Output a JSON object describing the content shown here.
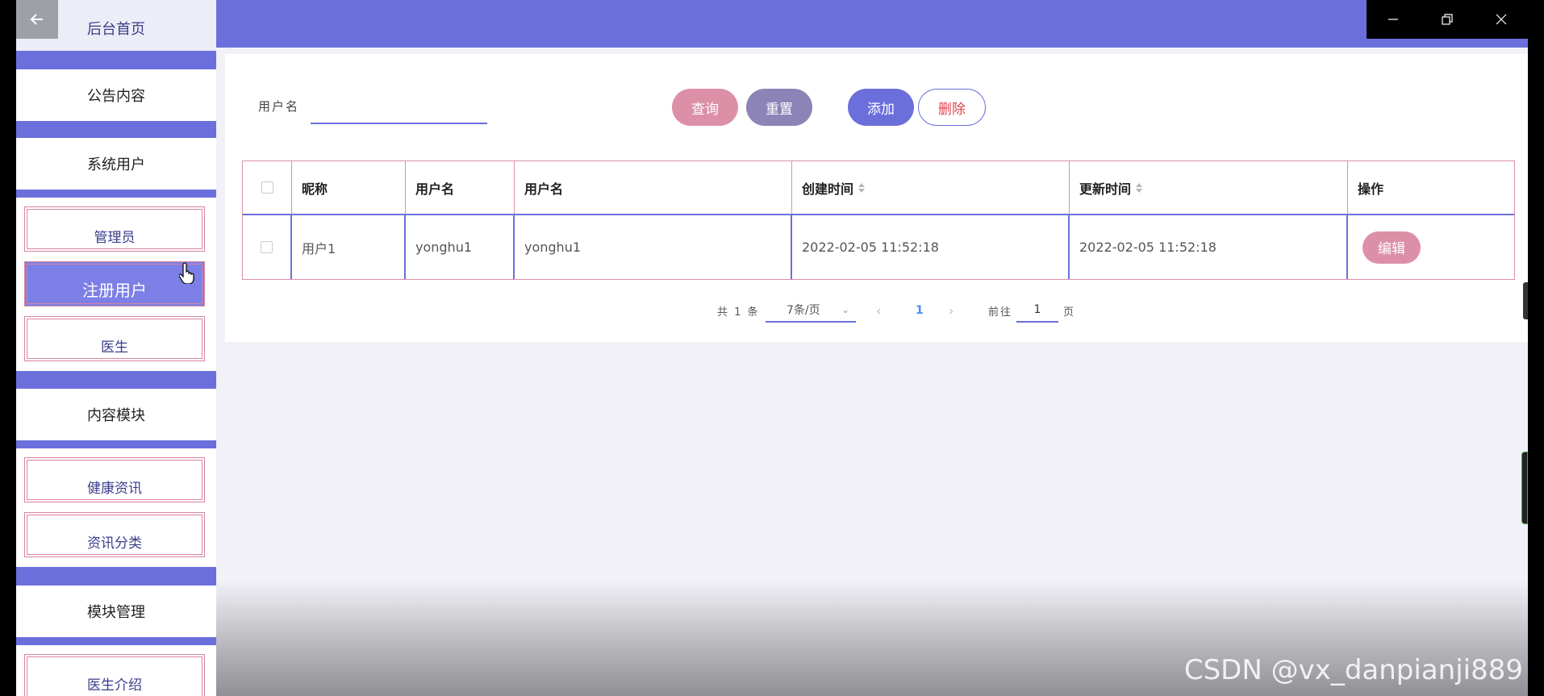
{
  "sidebar": {
    "home": "后台首页",
    "sections": [
      {
        "label": "公告内容"
      },
      {
        "label": "系统用户"
      },
      {
        "label": "内容模块"
      },
      {
        "label": "模块管理"
      }
    ],
    "sub_items": {
      "system_users": [
        "管理员",
        "注册用户",
        "医生"
      ],
      "content": [
        "健康资讯",
        "资讯分类"
      ],
      "modules": [
        "医生介绍"
      ]
    },
    "active_item": "注册用户"
  },
  "search": {
    "label": "用户名",
    "value": "",
    "placeholder": ""
  },
  "toolbar": {
    "query_label": "查询",
    "reset_label": "重置",
    "add_label": "添加",
    "delete_label": "删除"
  },
  "table": {
    "headers": [
      "昵称",
      "用户名",
      "用户名",
      "创建时间",
      "更新时间",
      "操作"
    ],
    "rows": [
      {
        "nickname": "用户1",
        "username": "yonghu1",
        "username2": "yonghu1",
        "created": "2022-02-05 11:52:18",
        "updated": "2022-02-05 11:52:18",
        "edit_label": "编辑"
      }
    ]
  },
  "pagination": {
    "total": "共 1 条",
    "page_size": "7条/页",
    "current_page": "1",
    "goto_label": "前往",
    "goto_value": "1",
    "page_suffix": "页"
  },
  "watermark": "CSDN @vx_danpianji889",
  "colors": {
    "primary": "#6b6fdc",
    "pink": "#dc90a8",
    "reset": "#8c83b6",
    "danger": "#e0424e"
  }
}
